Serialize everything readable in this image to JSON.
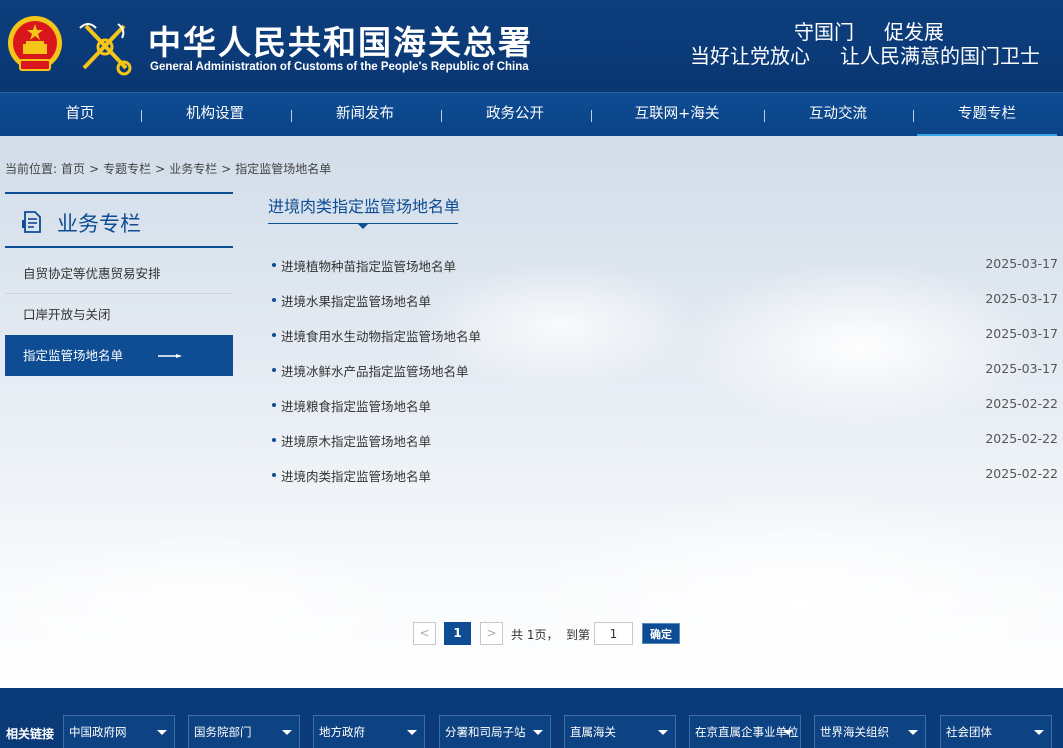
{
  "header": {
    "title": "中华人民共和国海关总署",
    "subtitle": "General Administration of Customs of the People's Republic of China",
    "slogan_line1": [
      "守国门",
      "促发展"
    ],
    "slogan_line2": [
      "当好让党放心",
      "让人民满意的国门卫士"
    ]
  },
  "nav": {
    "items": [
      {
        "label": "首页"
      },
      {
        "label": "机构设置"
      },
      {
        "label": "新闻发布"
      },
      {
        "label": "政务公开"
      },
      {
        "label": "互联网+海关"
      },
      {
        "label": "互动交流"
      },
      {
        "label": "专题专栏"
      }
    ],
    "active": "专题专栏"
  },
  "breadcrumb": {
    "prefix": "当前位置:",
    "items": [
      "首页",
      ">",
      "专题专栏",
      ">",
      "业务专栏",
      ">",
      "指定监管场地名单"
    ]
  },
  "sidebar": {
    "title": "业务专栏",
    "items": [
      {
        "label": "自贸协定等优惠贸易安排"
      },
      {
        "label": "口岸开放与关闭"
      },
      {
        "label": "指定监管场地名单"
      }
    ],
    "active": "指定监管场地名单"
  },
  "main": {
    "title": "进境肉类指定监管场地名单",
    "list": [
      {
        "title": "进境植物种苗指定监管场地名单",
        "date": "2025-03-17"
      },
      {
        "title": "进境水果指定监管场地名单",
        "date": "2025-03-17"
      },
      {
        "title": "进境食用水生动物指定监管场地名单",
        "date": "2025-03-17"
      },
      {
        "title": "进境冰鲜水产品指定监管场地名单",
        "date": "2025-03-17"
      },
      {
        "title": "进境粮食指定监管场地名单",
        "date": "2025-02-22"
      },
      {
        "title": "进境原木指定监管场地名单",
        "date": "2025-02-22"
      },
      {
        "title": "进境肉类指定监管场地名单",
        "date": "2025-02-22"
      }
    ]
  },
  "pagination": {
    "prev": "<",
    "current": "1",
    "next": ">",
    "total_text": "共 1页，",
    "goto_label": "到第",
    "goto_value": "1",
    "confirm_label": "确定"
  },
  "footer": {
    "label": "相关链接",
    "selects": [
      {
        "label": "中国政府网"
      },
      {
        "label": "国务院部门"
      },
      {
        "label": "地方政府"
      },
      {
        "label": "分署和司局子站"
      },
      {
        "label": "直属海关"
      },
      {
        "label": "在京直属企事业单位"
      },
      {
        "label": "世界海关组织"
      },
      {
        "label": "社会团体"
      }
    ]
  },
  "colors": {
    "primary": "#0e4c94",
    "header_bg": "#0b3a78",
    "nav_active_underline": "#39a3e8",
    "emblem_red": "#d8161b",
    "emblem_gold": "#f5c518"
  }
}
